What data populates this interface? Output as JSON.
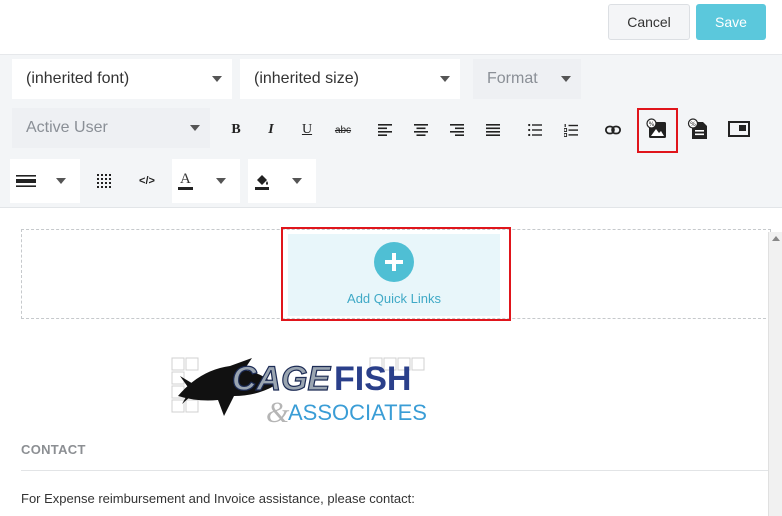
{
  "header": {
    "cancel_label": "Cancel",
    "save_label": "Save"
  },
  "toolbar": {
    "font_select": "(inherited font)",
    "size_select": "(inherited size)",
    "format_select": "Format",
    "user_select": "Active User",
    "bold": "B",
    "italic": "I",
    "underline": "U",
    "strike": "abc",
    "code": "</>",
    "text_color": "A",
    "icons": [
      "bold-icon",
      "italic-icon",
      "underline-icon",
      "strikethrough-icon",
      "align-left-icon",
      "align-center-icon",
      "align-right-icon",
      "justify-icon",
      "bulleted-list-icon",
      "numbered-list-icon",
      "link-icon",
      "insert-image-icon",
      "insert-document-icon",
      "embed-widget-icon",
      "horizontal-rule-icon",
      "table-grid-icon",
      "source-code-icon",
      "text-color-icon",
      "background-color-icon"
    ]
  },
  "editor": {
    "quick_links_label": "Add Quick Links",
    "logo": {
      "line1_a": "CAGE",
      "line1_b": "FISH",
      "line2_a": "&",
      "line2_b": "ASSOCIATES"
    },
    "section_heading": "CONTACT",
    "body_text": "For Expense reimbursement and Invoice assistance, please contact:"
  },
  "colors": {
    "accent": "#5bc8dc",
    "highlight": "#e0151b",
    "quick_links_bg": "#e8f6fa"
  }
}
